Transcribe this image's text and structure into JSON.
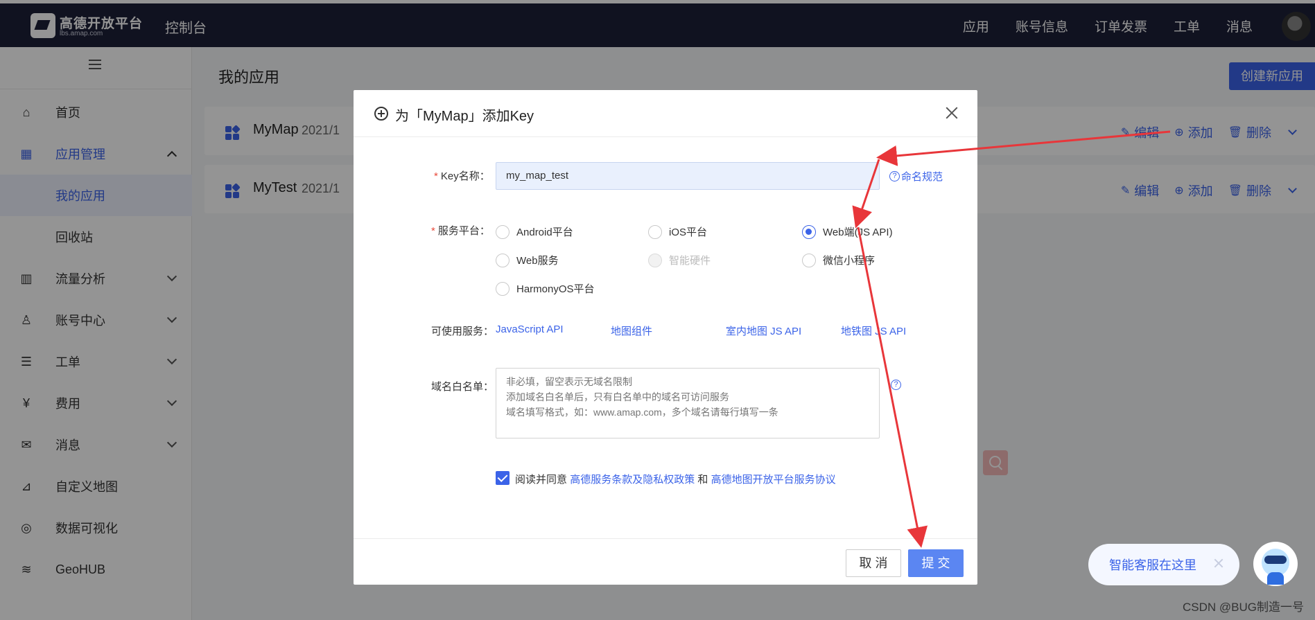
{
  "topbar": {
    "logo_text": "高德开放平台",
    "logo_sub": "lbs.amap.com",
    "console_title": "控制台",
    "nav": [
      "应用",
      "账号信息",
      "订单发票",
      "工单",
      "消息"
    ]
  },
  "sidebar": {
    "items": [
      {
        "label": "首页",
        "icon": "home-icon",
        "glyph": "⌂"
      },
      {
        "label": "应用管理",
        "icon": "grid-icon",
        "glyph": "▦"
      },
      {
        "label": "我的应用"
      },
      {
        "label": "回收站"
      },
      {
        "label": "流量分析",
        "icon": "chart-icon",
        "glyph": "▥"
      },
      {
        "label": "账号中心",
        "icon": "user-icon",
        "glyph": "♙"
      },
      {
        "label": "工单",
        "icon": "ticket-icon",
        "glyph": "☰"
      },
      {
        "label": "费用",
        "icon": "yuan-icon",
        "glyph": "¥"
      },
      {
        "label": "消息",
        "icon": "message-icon",
        "glyph": "✉"
      },
      {
        "label": "自定义地图",
        "icon": "map-icon",
        "glyph": "⊿"
      },
      {
        "label": "数据可视化",
        "icon": "visual-icon",
        "glyph": "◎"
      },
      {
        "label": "GeoHUB",
        "icon": "layers-icon",
        "glyph": "≋"
      }
    ]
  },
  "main": {
    "title": "我的应用",
    "create_button": "创建新应用",
    "apps": [
      {
        "name": "MyMap",
        "date": "2021/1"
      },
      {
        "name": "MyTest",
        "date": "2021/1"
      }
    ],
    "actions": {
      "edit": "编辑",
      "add": "添加",
      "delete": "删除"
    }
  },
  "dialog": {
    "title": "为「MyMap」添加Key",
    "key_label": "Key名称：",
    "key_value": "my_map_test",
    "naming_link": "命名规范",
    "platform_label": "服务平台：",
    "platforms": [
      {
        "label": "Android平台",
        "checked": false,
        "disabled": false
      },
      {
        "label": "iOS平台",
        "checked": false,
        "disabled": false
      },
      {
        "label": "Web端(JS API)",
        "checked": true,
        "disabled": false
      },
      {
        "label": "Web服务",
        "checked": false,
        "disabled": false
      },
      {
        "label": "智能硬件",
        "checked": false,
        "disabled": true
      },
      {
        "label": "微信小程序",
        "checked": false,
        "disabled": false
      },
      {
        "label": "HarmonyOS平台",
        "checked": false,
        "disabled": false
      }
    ],
    "services_label": "可使用服务：",
    "services": [
      "JavaScript API",
      "地图组件",
      "室内地图 JS API",
      "地铁图 JS API"
    ],
    "domain_label": "域名白名单：",
    "domain_placeholder": "非必填，留空表示无域名限制\n添加域名白名单后，只有白名单中的域名可访问服务\n域名填写格式，如：www.amap.com，多个域名请每行填写一条",
    "agree_prefix": "阅读并同意",
    "agree_link1": "高德服务条款及隐私权政策",
    "agree_and": "和",
    "agree_link2": "高德地图开放平台服务协议",
    "agree_checked": true,
    "cancel": "取 消",
    "submit": "提 交"
  },
  "chat": {
    "text": "智能客服在这里"
  },
  "watermark": "CSDN @BUG制造一号",
  "colors": {
    "primary": "#3b63e8",
    "topbar": "#1c1f37",
    "annotation_arrow": "#e8363a"
  }
}
